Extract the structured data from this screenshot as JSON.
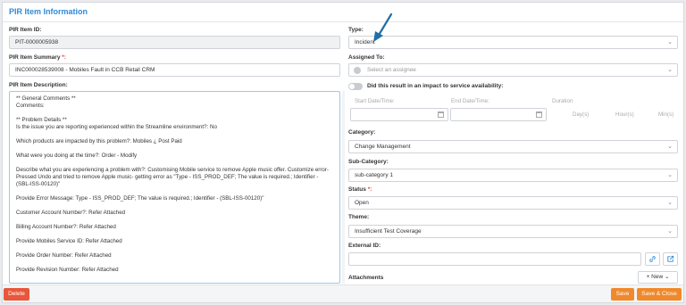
{
  "header": {
    "title": "PIR Item Information"
  },
  "left": {
    "id_label": "PIR Item ID:",
    "id_value": "PIT-0000005938",
    "summary_label": "PIR Item Summary",
    "summary_req": "*:",
    "summary_value": "INC000028539008 - Mobiles Fault in CCB Retail CRM",
    "desc_label": "PIR Item Description:",
    "description": [
      "** General Comments **\nComments:",
      "** Problem Details **\nIs the issue you are reporting experienced within the Streamline environment?: No",
      "Which products are impacted by this problem?: Mobiles ¿ Post Paid",
      "What were you doing at the time?: Order - Modify",
      "Describe what you are experiencing a problem with?: Customising Mobile service to remove Apple music offer. Customize error- Pressed Undo and tried to remove Apple music- getting error as \"Type - ISS_PROD_DEF; The value is required.; Identifier - (SBL-ISS-00120)\"",
      "Provide Error Message: Type - ISS_PROD_DEF; The value is required.; Identifier - (SBL-ISS-00120)\"",
      "Customer Account Number?: Refer Attached",
      "Billing Account Number?: Refer Attached",
      "Provide Mobiles Service ID: Refer Attached",
      "Provide Order Number: Refer Attached",
      "Provide Revision Number: Refer Attached"
    ]
  },
  "right": {
    "type_label": "Type:",
    "type_value": "Incident",
    "assigned_label": "Assigned To:",
    "assigned_placeholder": "Select an assignee",
    "impact_label": "Did this result in an impact to service availability:",
    "start_label": "Start Date/Time:",
    "end_label": "End Date/Time:",
    "duration_label": "Duration",
    "days": "Day(s)",
    "hours": "Hour(s)",
    "mins": "Min(s)",
    "category_label": "Category:",
    "category_value": "Change Management",
    "subcategory_label": "Sub-Category:",
    "subcategory_value": "sub-category 1",
    "status_label": "Status",
    "status_req": "*:",
    "status_value": "Open",
    "theme_label": "Theme:",
    "theme_value": "Insufficient Test Coverage",
    "external_label": "External ID:",
    "external_value": "",
    "attachments_label": "Attachments",
    "new_label": "+ New ⌄"
  },
  "footer": {
    "delete_label": "Delete",
    "save_label": "Save",
    "save_close_label": "Save & Close"
  },
  "colors": {
    "accent": "#2e8bd6",
    "delete": "#e8573b",
    "save": "#f0892b",
    "arrow": "#1e6fa8"
  },
  "icons": {
    "chevron": "chevron-down-icon",
    "calendar": "calendar-icon",
    "link": "link-icon",
    "external": "external-link-icon",
    "avatar": "user-avatar-icon"
  }
}
